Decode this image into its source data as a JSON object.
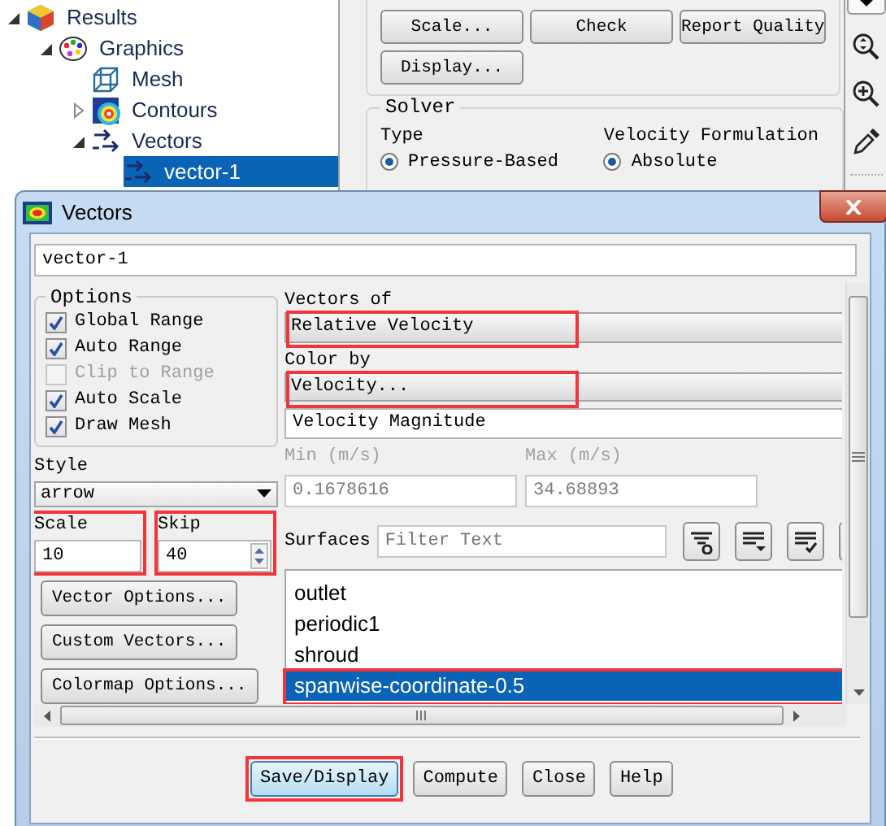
{
  "tree": [
    {
      "label": "Results",
      "kind": "results",
      "expanded": true,
      "selected": false,
      "children": [
        {
          "label": "Graphics",
          "kind": "graphics",
          "expanded": true,
          "selected": false,
          "children": [
            {
              "label": "Mesh",
              "kind": "mesh",
              "selected": false
            },
            {
              "label": "Contours",
              "kind": "contours",
              "expanded": false,
              "selected": false
            },
            {
              "label": "Vectors",
              "kind": "vectors",
              "expanded": true,
              "selected": false,
              "children": [
                {
                  "label": "vector-1",
                  "kind": "vector",
                  "selected": true
                }
              ]
            }
          ]
        }
      ]
    }
  ],
  "buttons": [
    "Scale...",
    "Check",
    "Report Quality",
    "Display..."
  ],
  "solver": {
    "title": "Solver",
    "type_label": "Type",
    "velocity_label": "Velocity Formulation",
    "type_options": [
      {
        "label": "Pressure-Based",
        "selected": true
      }
    ],
    "velocity_options": [
      {
        "label": "Absolute",
        "selected": true
      }
    ]
  },
  "dialog": {
    "title": "Vectors",
    "name": "vector-1",
    "options": {
      "title": "Options",
      "items": [
        {
          "label": "Global Range",
          "checked": true,
          "disabled": false
        },
        {
          "label": "Auto Range",
          "checked": true,
          "disabled": false
        },
        {
          "label": "Clip to Range",
          "checked": false,
          "disabled": true
        },
        {
          "label": "Auto Scale",
          "checked": true,
          "disabled": false
        },
        {
          "label": "Draw Mesh",
          "checked": true,
          "disabled": false
        }
      ]
    },
    "style": {
      "label": "Style",
      "value": "arrow"
    },
    "scale": {
      "label": "Scale",
      "value": "10",
      "highlighted": true
    },
    "skip": {
      "label": "Skip",
      "value": "40",
      "highlighted": true
    },
    "side_buttons": [
      "Vector Options...",
      "Custom Vectors...",
      "Colormap Options..."
    ],
    "vectors_of": {
      "label": "Vectors of",
      "value": "Relative Velocity",
      "highlighted": true
    },
    "color_by": {
      "label": "Color by",
      "value": "Velocity...",
      "highlighted": true
    },
    "color_by_field": "Velocity Magnitude",
    "min": {
      "label": "Min (m/s)",
      "value": "0.1678616",
      "disabled": true
    },
    "max": {
      "label": "Max (m/s)",
      "value": "34.68893",
      "disabled": true
    },
    "surfaces": {
      "label": "Surfaces",
      "placeholder": "Filter Text",
      "items": [
        {
          "label": "outlet",
          "selected": false,
          "highlighted": false
        },
        {
          "label": "periodic1",
          "selected": false,
          "highlighted": false
        },
        {
          "label": "shroud",
          "selected": false,
          "highlighted": false
        },
        {
          "label": "spanwise-coordinate-0.5",
          "selected": true,
          "highlighted": true
        }
      ]
    },
    "buttons": [
      {
        "label": "Save/Display",
        "highlighted": true
      },
      {
        "label": "Compute",
        "highlighted": false
      },
      {
        "label": "Close",
        "highlighted": false
      },
      {
        "label": "Help",
        "highlighted": false
      }
    ]
  }
}
